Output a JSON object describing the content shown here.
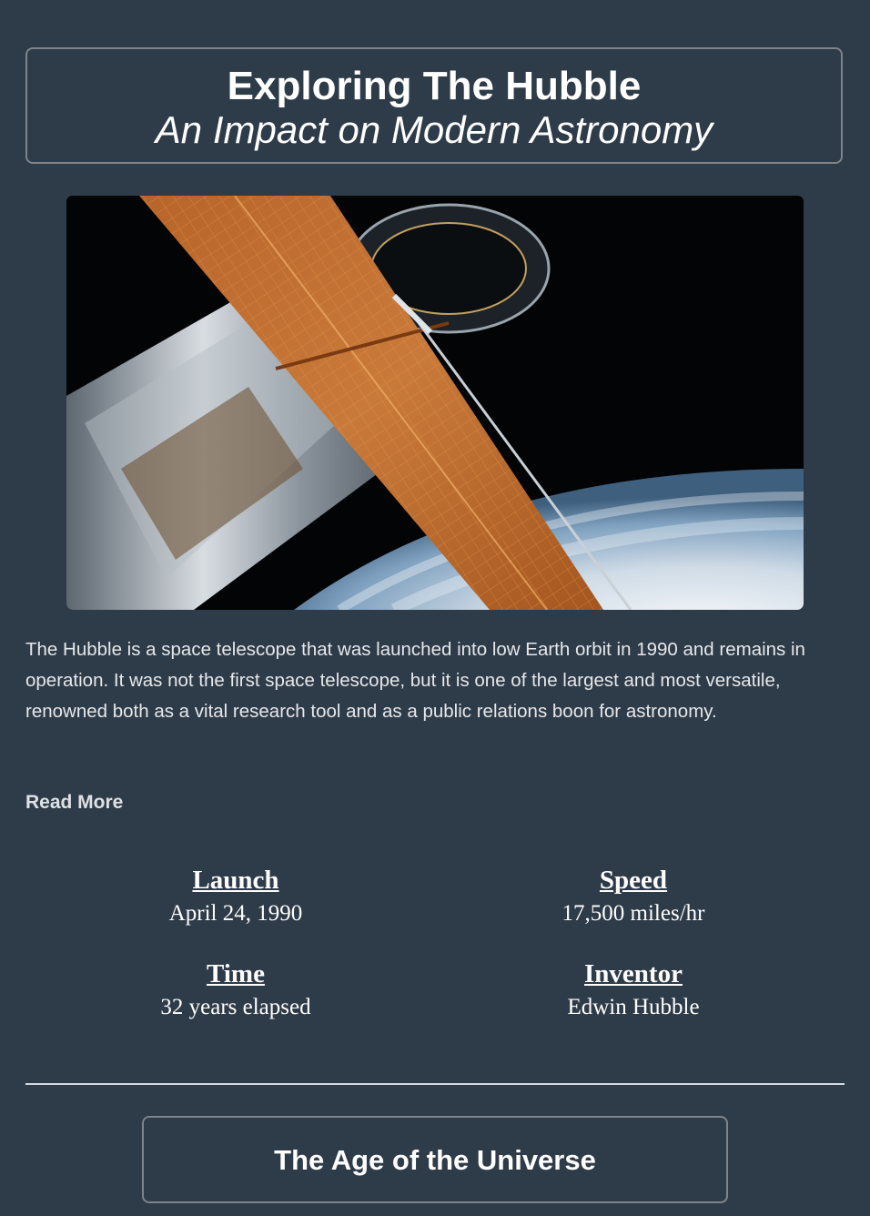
{
  "header": {
    "title": "Exploring The Hubble",
    "subtitle": "An Impact on Modern Astronomy"
  },
  "hero_image": {
    "alt": "Hubble Space Telescope in orbit above Earth"
  },
  "intro": {
    "text": "The Hubble is a space telescope that was launched into low Earth orbit in 1990 and remains in operation. It was not the first space telescope, but it is one of the largest and most versatile, renowned both as a vital research tool and as a public relations boon for astronomy."
  },
  "read_more": {
    "label": "Read More"
  },
  "facts": [
    {
      "label": "Launch",
      "value": "April 24, 1990"
    },
    {
      "label": "Speed",
      "value": "17,500 miles/hr"
    },
    {
      "label": "Time",
      "value": "32 years elapsed"
    },
    {
      "label": "Inventor",
      "value": "Edwin Hubble"
    }
  ],
  "next_section": {
    "title": "The Age of the Universe"
  },
  "colors": {
    "background": "#2e3b48",
    "border": "#7d848b",
    "text": "#ffffff"
  }
}
